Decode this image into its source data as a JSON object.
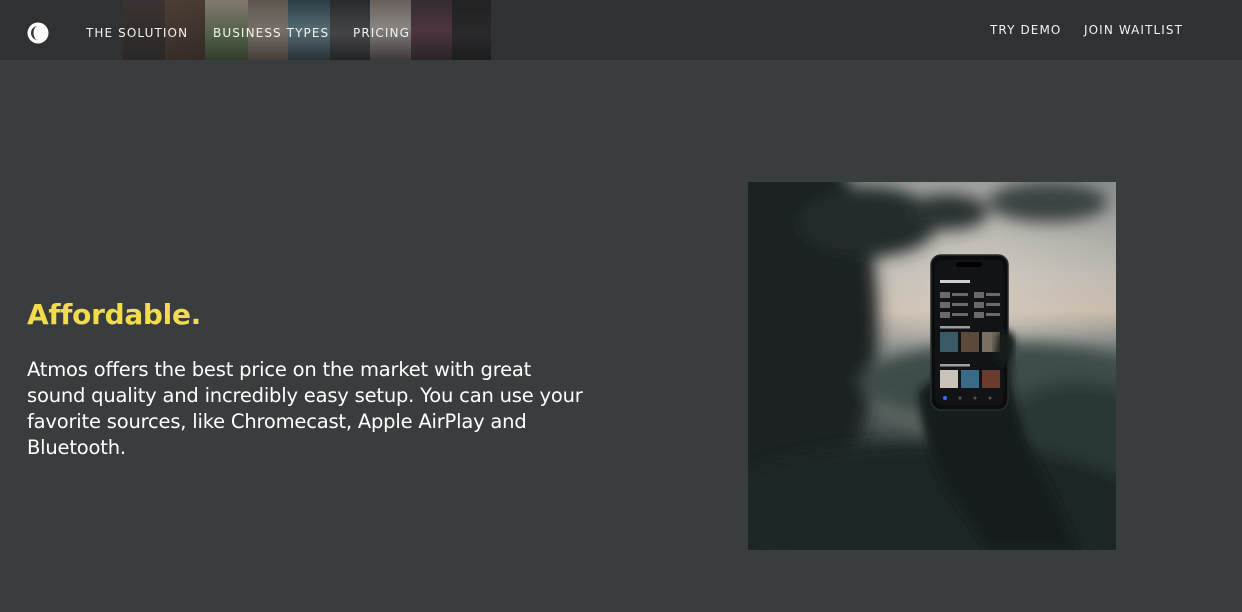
{
  "nav": {
    "logo_icon": "half-moon-logo-icon",
    "links": [
      "THE SOLUTION",
      "BUSINESS TYPES",
      "PRICING"
    ],
    "try_demo": "TRY DEMO",
    "join_waitlist": "JOIN WAITLIST"
  },
  "feature": {
    "heading": "Affordable.",
    "description": "Atmos offers the best price on the market with great sound quality and incredibly easy setup. You can use your favorite sources, like Chromecast, Apple AirPlay and Bluetooth."
  },
  "colors": {
    "background": "#393d3e",
    "nav_background": "#333637",
    "accent_yellow": "#f2dc4e",
    "text": "#ffffff"
  }
}
